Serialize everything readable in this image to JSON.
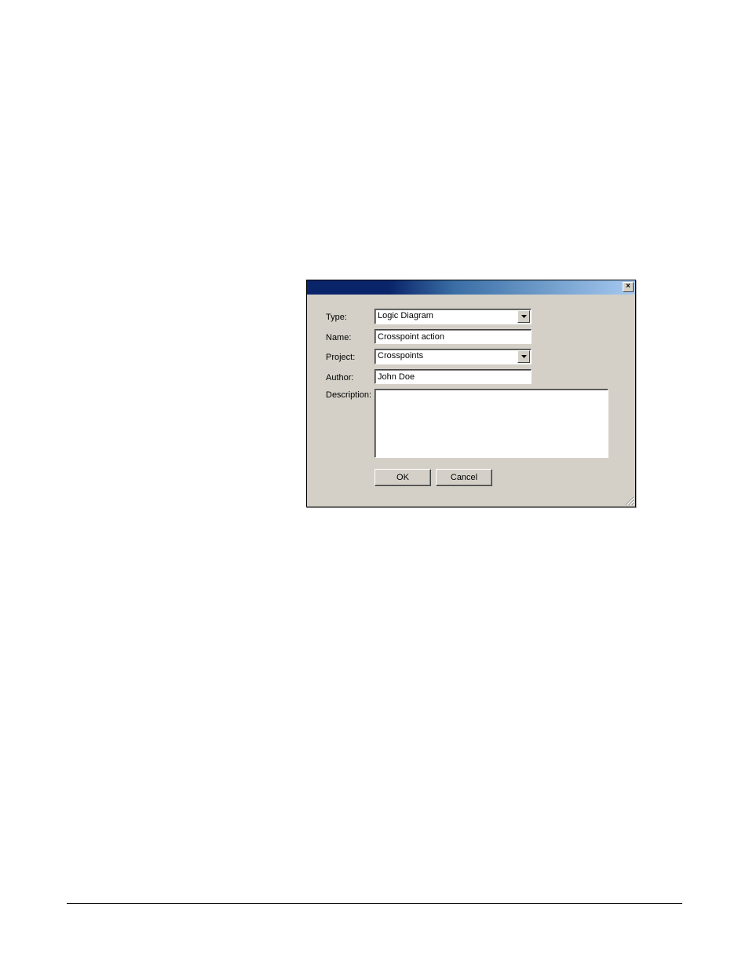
{
  "dialog": {
    "close_symbol": "✕",
    "fields": {
      "type": {
        "label": "Type:",
        "value": "Logic Diagram"
      },
      "name": {
        "label": "Name:",
        "value": "Crosspoint action"
      },
      "project": {
        "label": "Project:",
        "value": "Crosspoints"
      },
      "author": {
        "label": "Author:",
        "value": "John Doe"
      },
      "description": {
        "label": "Description:",
        "value": ""
      }
    },
    "buttons": {
      "ok": "OK",
      "cancel": "Cancel"
    }
  }
}
